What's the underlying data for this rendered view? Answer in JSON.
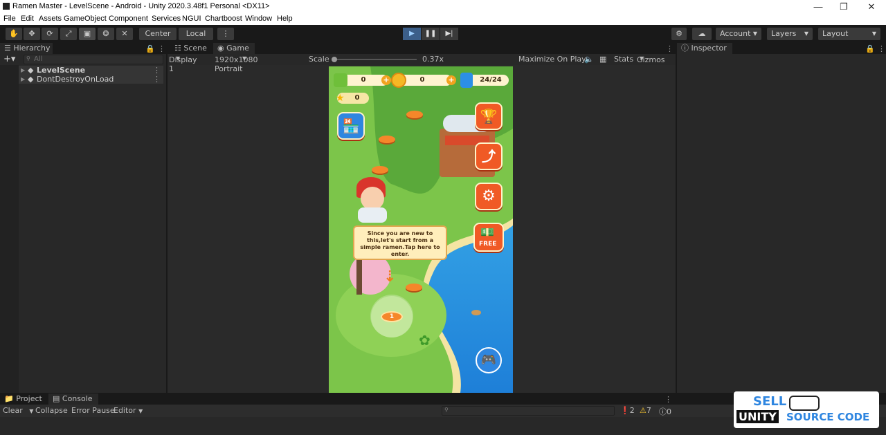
{
  "window": {
    "title": "Ramen Master - LevelScene - Android - Unity 2020.3.48f1 Personal <DX11>",
    "minimize_icon": "minimize-icon",
    "maximize_icon": "restore-icon",
    "close_icon": "close-icon"
  },
  "menu": [
    "File",
    "Edit",
    "Assets",
    "GameObject",
    "Component",
    "Services",
    "NGUI",
    "Chartboost",
    "Window",
    "Help"
  ],
  "toolbar": {
    "pivot_center": "Center",
    "pivot_local": "Local",
    "account": "Account",
    "layers": "Layers",
    "layout": "Layout"
  },
  "hierarchy": {
    "tab": "Hierarchy",
    "search_placeholder": "All",
    "items": [
      {
        "label": "LevelScene"
      },
      {
        "label": "DontDestroyOnLoad"
      }
    ]
  },
  "game_view": {
    "tab_scene": "Scene",
    "tab_game": "Game",
    "display": "Display 1",
    "resolution": "1920x1080 Portrait",
    "scale_label": "Scale",
    "scale_value": "0.37x",
    "maximize": "Maximize On Play",
    "stats": "Stats",
    "gizmos": "Gizmos"
  },
  "game": {
    "cash": "0",
    "coins": "0",
    "energy": "24/24",
    "stars": "0",
    "dialog": "Since you are new to this,let's start from a simple ramen.Tap here to enter.",
    "level_number": "1",
    "free_label": "FREE"
  },
  "inspector": {
    "tab": "Inspector"
  },
  "bottom": {
    "tab_project": "Project",
    "tab_console": "Console",
    "clear": "Clear",
    "collapse": "Collapse",
    "error_pause": "Error Pause",
    "editor": "Editor",
    "log_count": "2",
    "warn_count": "7",
    "error_count": "0"
  },
  "watermark": {
    "line1": "SELL",
    "line2a": "UNITY",
    "line2b": "SOURCE CODE"
  },
  "colors": {
    "play_active": "#3c5f8a",
    "editor_bg": "#282828",
    "accent_orange": "#f05a25"
  }
}
